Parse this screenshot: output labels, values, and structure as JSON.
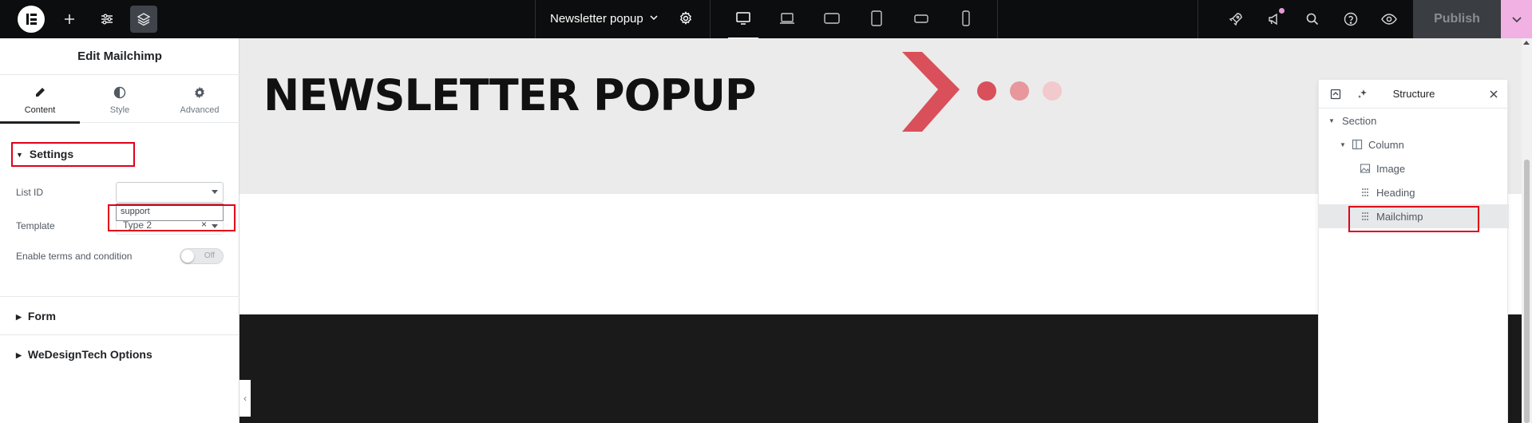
{
  "topbar": {
    "document_title": "Newsletter popup",
    "publish_label": "Publish",
    "device_modes": [
      "desktop",
      "laptop",
      "tablet-landscape",
      "tablet-portrait",
      "mobile-landscape",
      "mobile-portrait"
    ],
    "active_device": "desktop"
  },
  "panel": {
    "title": "Edit Mailchimp",
    "tabs": [
      {
        "label": "Content",
        "icon": "pencil-icon",
        "active": true
      },
      {
        "label": "Style",
        "icon": "half-circle-icon",
        "active": false
      },
      {
        "label": "Advanced",
        "icon": "gear-icon",
        "active": false
      }
    ],
    "settings": {
      "heading": "Settings",
      "list_id_label": "List ID",
      "list_id_value": "",
      "list_id_option": "support",
      "template_label": "Template",
      "template_value": "Type 2",
      "terms_label": "Enable terms and condition",
      "terms_toggle": "Off"
    },
    "sections": [
      {
        "label": "Form"
      },
      {
        "label": "WeDesignTech Options"
      }
    ]
  },
  "canvas": {
    "heading": "NEWSLETTER POPUP",
    "accent_colors": [
      "#d9505a",
      "#e8979c",
      "#f2c9cc"
    ]
  },
  "structure": {
    "title": "Structure",
    "items": [
      {
        "label": "Section",
        "icon": "caret-down-icon",
        "level": 0
      },
      {
        "label": "Column",
        "icon": "column-icon",
        "level": 1
      },
      {
        "label": "Image",
        "icon": "image-icon",
        "level": 2
      },
      {
        "label": "Heading",
        "icon": "grid-dots-icon",
        "level": 2
      },
      {
        "label": "Mailchimp",
        "icon": "grid-dots-icon",
        "level": 2,
        "selected": true
      }
    ]
  }
}
